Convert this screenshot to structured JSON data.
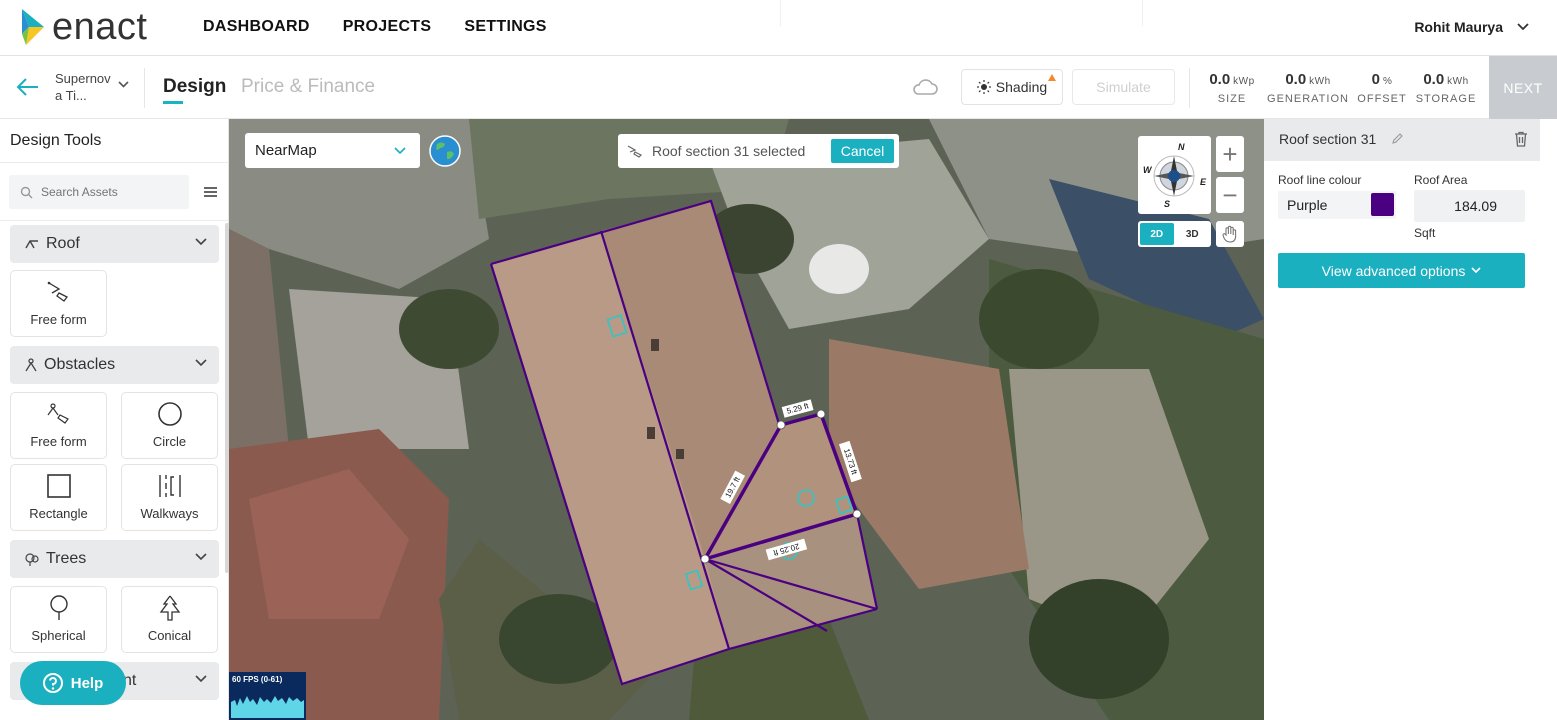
{
  "app": {
    "brand": "enact"
  },
  "nav": {
    "items": [
      "DASHBOARD",
      "PROJECTS",
      "SETTINGS"
    ]
  },
  "user": {
    "name": "Rohit Maurya"
  },
  "project": {
    "name_line1": "Supernov",
    "name_line2": "a Ti..."
  },
  "tabs": {
    "design": "Design",
    "price": "Price & Finance"
  },
  "toolbar": {
    "shading": "Shading",
    "simulate": "Simulate",
    "next": "NEXT"
  },
  "stats": [
    {
      "value": "0.0",
      "unit": "kWp",
      "label": "SIZE"
    },
    {
      "value": "0.0",
      "unit": "kWh",
      "label": "GENERATION"
    },
    {
      "value": "0",
      "unit": "%",
      "label": "OFFSET"
    },
    {
      "value": "0.0",
      "unit": "kWh",
      "label": "STORAGE"
    }
  ],
  "left": {
    "title": "Design Tools",
    "search_placeholder": "Search Assets",
    "sections": {
      "roof": {
        "label": "Roof",
        "tools": [
          "Free form"
        ]
      },
      "obstacles": {
        "label": "Obstacles",
        "tools": [
          "Free form",
          "Circle",
          "Rectangle",
          "Walkways"
        ]
      },
      "trees": {
        "label": "Trees",
        "tools": [
          "Spherical",
          "Conical"
        ]
      },
      "partial_label": "nt"
    },
    "help": "Help"
  },
  "map": {
    "imagery": "NearMap",
    "selection_text": "Roof section 31 selected",
    "cancel": "Cancel",
    "compass": {
      "n": "N",
      "e": "E",
      "s": "S",
      "w": "W"
    },
    "view_2d": "2D",
    "view_3d": "3D",
    "fps": "60 FPS (0-61)",
    "measurements": [
      "5.29 ft",
      "13.73 ft",
      "19.7 ft",
      "20.25 ft"
    ]
  },
  "right": {
    "title": "Roof section 31",
    "roof_line_label": "Roof line colour",
    "roof_line_value": "Purple",
    "roof_line_color": "#4a0080",
    "roof_area_label": "Roof Area",
    "roof_area_value": "184.09",
    "roof_area_unit": "Sqft",
    "advanced": "View advanced options"
  },
  "colors": {
    "accent": "#1ab0bf",
    "roof_outline": "#4a0080"
  }
}
